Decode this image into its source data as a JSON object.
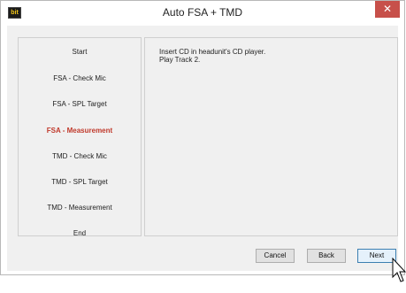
{
  "window": {
    "title": "Auto FSA + TMD",
    "icon_text": "bit",
    "close_symbol": "✕"
  },
  "steps": [
    {
      "label": "Start",
      "active": false
    },
    {
      "label": "FSA - Check Mic",
      "active": false
    },
    {
      "label": "FSA - SPL Target",
      "active": false
    },
    {
      "label": "FSA - Measurement",
      "active": true
    },
    {
      "label": "TMD - Check Mic",
      "active": false
    },
    {
      "label": "TMD - SPL Target",
      "active": false
    },
    {
      "label": "TMD - Measurement",
      "active": false
    },
    {
      "label": "End",
      "active": false
    }
  ],
  "content": {
    "line1": "Insert CD in headunit's CD player.",
    "line2": "Play Track 2."
  },
  "buttons": {
    "cancel": "Cancel",
    "back": "Back",
    "next": "Next"
  },
  "colors": {
    "active_step": "#c0392b",
    "close_button": "#c7504a"
  }
}
